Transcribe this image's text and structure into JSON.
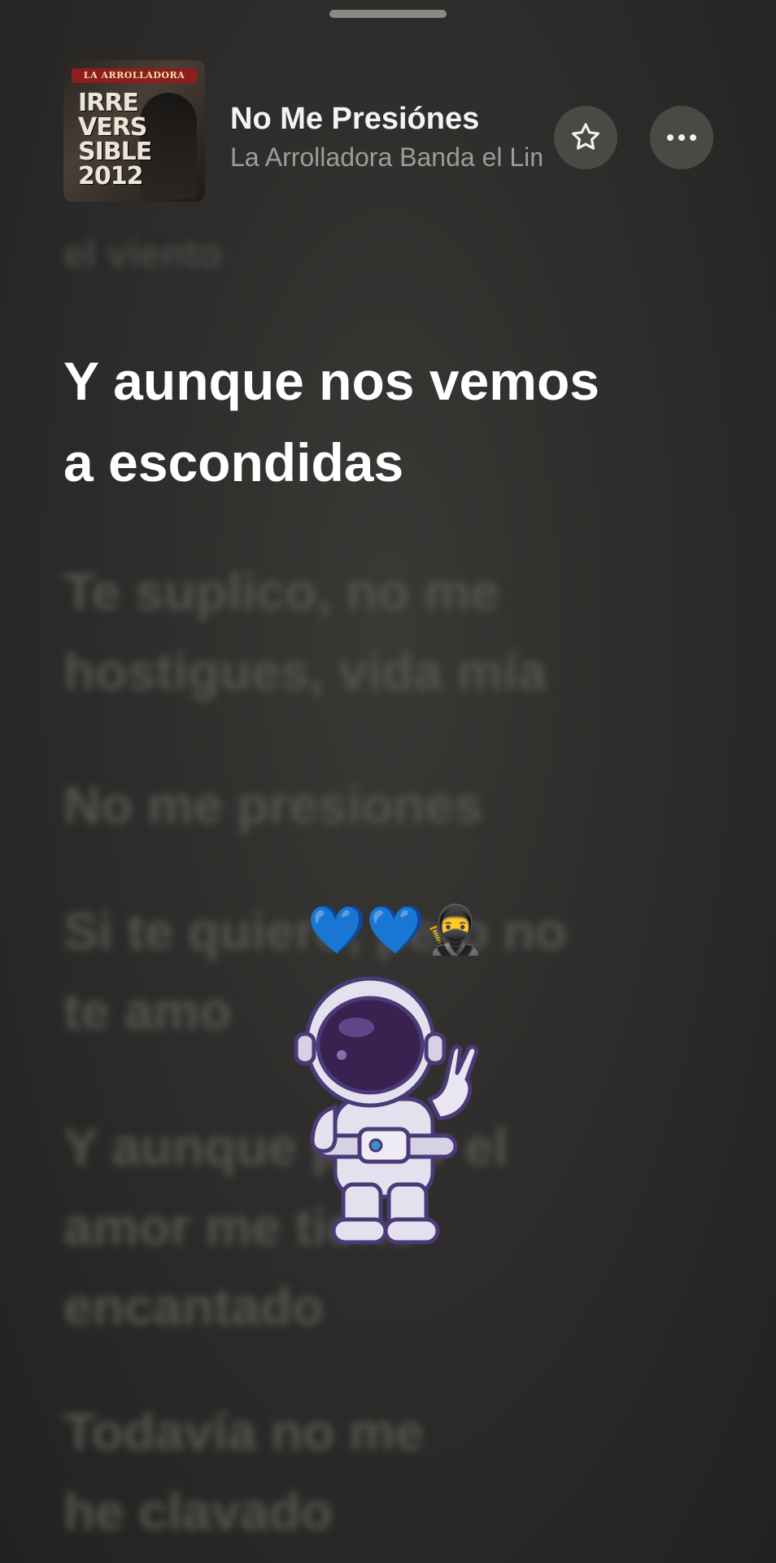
{
  "now_playing": {
    "song_title": "No Me Presiónes",
    "artist": "La Arrolladora Banda el Limón",
    "album_cover": {
      "brand": "LA ARROLLADORA",
      "text": "IRRE\nVERS\nSIBLE\n2012"
    },
    "favorite_icon": "star-outline-icon",
    "more_icon": "ellipsis-icon"
  },
  "lyrics": {
    "previous_partial": "el viento",
    "active": [
      "Y aunque nos vemos",
      "a escondidas"
    ],
    "upcoming": [
      [
        "Te suplico, no me",
        "hostigues, vida mía"
      ],
      [
        "No me presiones"
      ],
      [
        "Si te quiero, pero no",
        "te amo"
      ],
      [
        "Y aunque pasar el",
        "amor me tiene",
        "encantado"
      ],
      [
        "Todavía no me",
        "he clavado"
      ]
    ]
  },
  "sticker": {
    "emojis": "💙💙🥷",
    "image": "astronaut-peace-sign"
  },
  "colors": {
    "background": "#2c2b29",
    "active_lyric": "#ffffff",
    "faded_lyric": "#55534f",
    "astronaut_visor": "#3a2250",
    "astronaut_accent": "#7b5bc4"
  }
}
